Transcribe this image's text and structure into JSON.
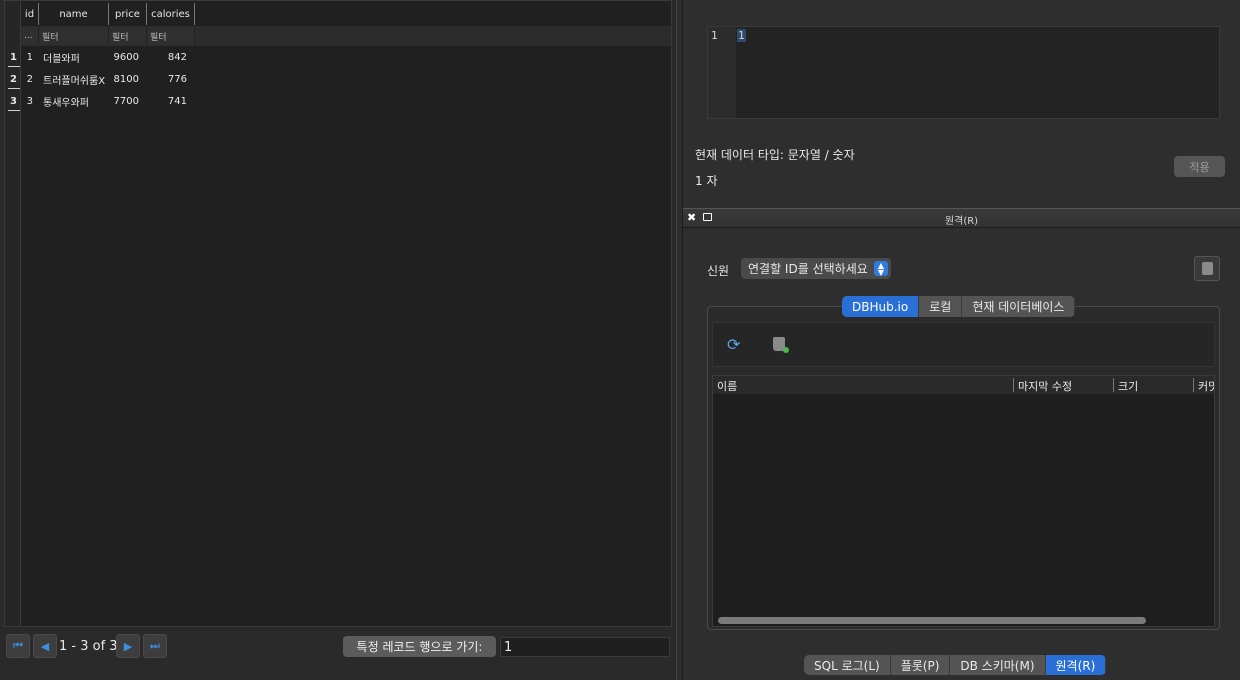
{
  "grid": {
    "columns": [
      "id",
      "name",
      "price",
      "calories"
    ],
    "filter_row_marker": "...",
    "filter_placeholder": "필터",
    "rows": [
      {
        "row_num": "1",
        "id": "1",
        "name": "더블와퍼",
        "price": "9600",
        "calories": "842"
      },
      {
        "row_num": "2",
        "id": "2",
        "name": "트러플머쉬룸X",
        "price": "8100",
        "calories": "776"
      },
      {
        "row_num": "3",
        "id": "3",
        "name": "통새우와퍼",
        "price": "7700",
        "calories": "741"
      }
    ]
  },
  "navigation": {
    "first_icon": "first-record-icon",
    "prev_icon": "prev-record-icon",
    "next_icon": "next-record-icon",
    "last_icon": "last-record-icon",
    "record_count": "1 - 3 of 3",
    "goto_label": "특정 레코드 행으로 가기:",
    "goto_value": "1"
  },
  "editor": {
    "line_number": "1",
    "content": "1",
    "data_type": "현재 데이터 타입: 문자열 / 숫자",
    "char_count": "1 자",
    "apply_label": "적용"
  },
  "remote": {
    "title": "원격(R)",
    "identity_label": "신원",
    "identity_select": "연결할 ID를 선택하세요",
    "tabs": [
      {
        "label": "DBHub.io",
        "active": true
      },
      {
        "label": "로컬",
        "active": false
      },
      {
        "label": "현재 데이터베이스",
        "active": false
      }
    ],
    "table_headers": [
      "이름",
      "마지막 수정",
      "크기",
      "커밋"
    ]
  },
  "dock_tabs": [
    {
      "label": "SQL 로그(L)",
      "active": false
    },
    {
      "label": "플롯(P)",
      "active": false
    },
    {
      "label": "DB 스키마(M)",
      "active": false
    },
    {
      "label": "원격(R)",
      "active": true
    }
  ],
  "colors": {
    "accent": "#2a6fd6",
    "grid_bg": "#202020",
    "panel_bg": "#2e2e2e"
  }
}
